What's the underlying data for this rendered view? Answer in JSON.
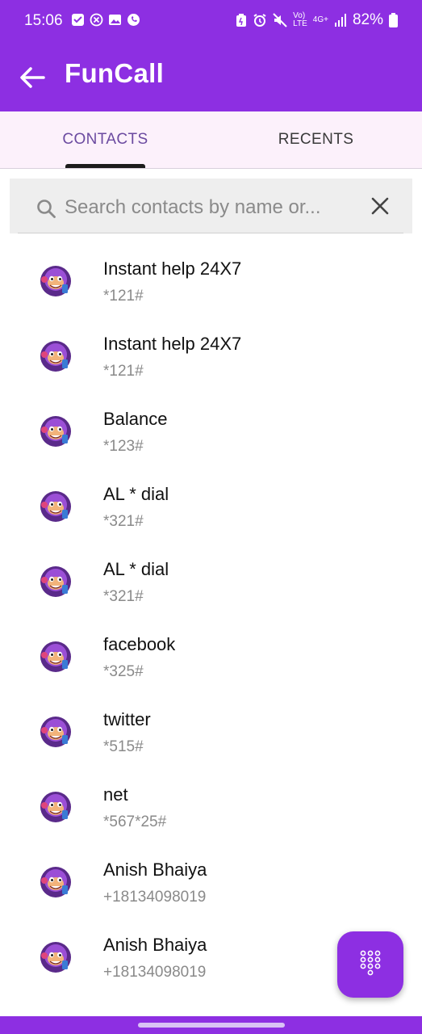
{
  "status_bar": {
    "time": "15:06",
    "network_small": "Vo)\nLTE",
    "network_type": "4G+",
    "battery": "82%"
  },
  "app_bar": {
    "title": "FunCall",
    "back_icon": "arrow-left-icon"
  },
  "tabs": [
    {
      "label": "CONTACTS",
      "selected": true
    },
    {
      "label": "RECENTS",
      "selected": false
    }
  ],
  "search": {
    "placeholder": "Search contacts by name or...",
    "value": ""
  },
  "contacts": [
    {
      "name": "Instant help 24X7",
      "number": "*121#"
    },
    {
      "name": "Instant help 24X7",
      "number": "*121#"
    },
    {
      "name": "Balance",
      "number": "*123#"
    },
    {
      "name": "AL * dial",
      "number": "*321#"
    },
    {
      "name": "AL * dial",
      "number": "*321#"
    },
    {
      "name": "facebook",
      "number": "*325#"
    },
    {
      "name": "twitter",
      "number": "*515#"
    },
    {
      "name": "net",
      "number": "*567*25#"
    },
    {
      "name": "Anish Bhaiya",
      "number": "+18134098019"
    },
    {
      "name": "Anish Bhaiya",
      "number": "+18134098019"
    }
  ],
  "colors": {
    "primary": "#8d2fe2",
    "tab_bg": "#fcf1fb",
    "tab_selected_text": "#6b4aa0",
    "secondary_text": "#8a8a8a"
  },
  "fab_icon": "dialpad-icon"
}
